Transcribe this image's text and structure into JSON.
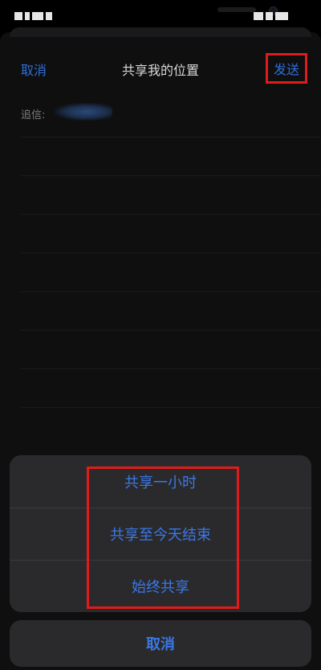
{
  "nav": {
    "cancel_label": "取消",
    "title": "共享我的位置",
    "send_label": "发送"
  },
  "to_label": "追信:",
  "actions": {
    "items": [
      "共享一小时",
      "共享至今天结束",
      "始终共享"
    ]
  },
  "bottom": {
    "cancel_label": "取消"
  },
  "colors": {
    "accent": "#3b78e6",
    "highlight": "#e01b1b",
    "background": "#0f0f10",
    "action_bg": "#2a2a2c"
  }
}
